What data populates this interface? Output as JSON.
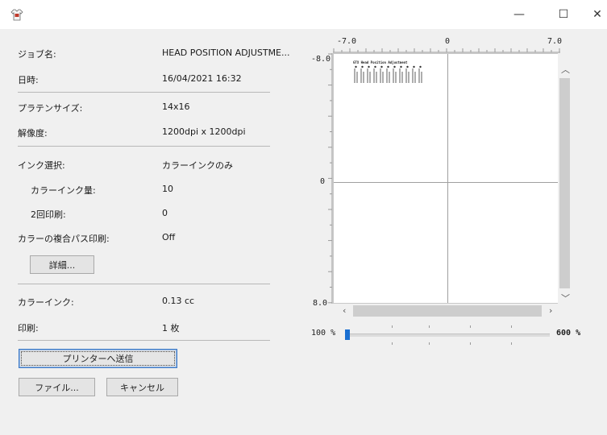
{
  "window": {
    "minimize_glyph": "—",
    "maximize_glyph": "☐",
    "close_glyph": "✕",
    "app_icon": "tshirt-printer-icon"
  },
  "job": {
    "name_label": "ジョブ名:",
    "name_value": "HEAD POSITION ADJUSTME...",
    "datetime_label": "日時:",
    "datetime_value": "16/04/2021 16:32"
  },
  "media": {
    "platen_label": "プラテンサイズ:",
    "platen_value": "14x16",
    "resolution_label": "解像度:",
    "resolution_value": "1200dpi x 1200dpi"
  },
  "ink": {
    "select_label": "インク選択:",
    "select_value": "カラーインクのみ",
    "amount_label": "カラーインク量:",
    "amount_value": "10",
    "double_label": "2回印刷:",
    "double_value": "0",
    "multipass_label": "カラーの複合パス印刷:",
    "multipass_value": "Off",
    "details_button": "詳細..."
  },
  "usage": {
    "color_label": "カラーインク:",
    "color_value": "0.13 cc",
    "print_label": "印刷:",
    "print_value": "1 枚"
  },
  "actions": {
    "send_button": "プリンターへ送信",
    "file_button": "ファイル...",
    "cancel_button": "キャンセル"
  },
  "preview": {
    "x_labels": [
      "-7.0",
      "0",
      "7.0"
    ],
    "y_labels": [
      "-8.0",
      "0",
      "8.0"
    ],
    "thumbnail_title": "GTX Head Position Adjustment",
    "zoom_min": "100 %",
    "zoom_max": "600 %",
    "zoom_level": 0
  },
  "colors": {
    "accent": "#1a6fd1",
    "window_bg": "#f0f0f0"
  }
}
